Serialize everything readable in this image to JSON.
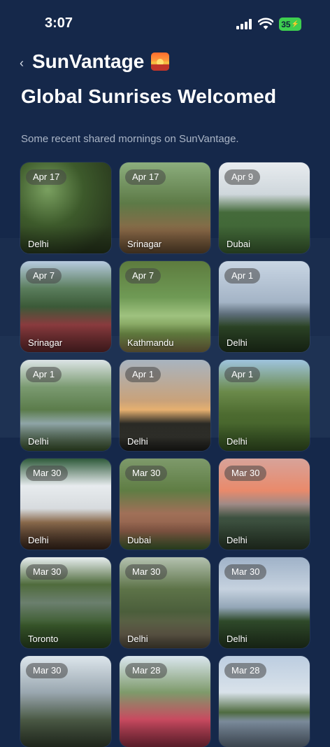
{
  "status": {
    "time": "3:07",
    "battery": "35"
  },
  "header": {
    "back_icon": "‹",
    "app_name": "SunVantage",
    "title": "Global Sunrises Welcomed",
    "subtitle": "Some recent shared mornings on SunVantage."
  },
  "photos": [
    {
      "date": "Apr 17",
      "place": "Delhi",
      "scene": "s-jungle"
    },
    {
      "date": "Apr 17",
      "place": "Srinagar",
      "scene": "s-park"
    },
    {
      "date": "Apr 9",
      "place": "Dubai",
      "scene": "s-gazebo"
    },
    {
      "date": "Apr 7",
      "place": "Srinagar",
      "scene": "s-garden"
    },
    {
      "date": "Apr 7",
      "place": "Kathmandu",
      "scene": "s-lake"
    },
    {
      "date": "Apr 1",
      "place": "Delhi",
      "scene": "s-hills"
    },
    {
      "date": "Apr 1",
      "place": "Delhi",
      "scene": "s-pond"
    },
    {
      "date": "Apr 1",
      "place": "Delhi",
      "scene": "s-dawnlake"
    },
    {
      "date": "Apr 1",
      "place": "Delhi",
      "scene": "s-trees"
    },
    {
      "date": "Mar 30",
      "place": "Delhi",
      "scene": "s-balcony"
    },
    {
      "date": "Mar 30",
      "place": "Dubai",
      "scene": "s-path"
    },
    {
      "date": "Mar 30",
      "place": "Delhi",
      "scene": "s-dusk"
    },
    {
      "date": "Mar 30",
      "place": "Toronto",
      "scene": "s-fountain"
    },
    {
      "date": "Mar 30",
      "place": "Delhi",
      "scene": "s-woods"
    },
    {
      "date": "Mar 30",
      "place": "Delhi",
      "scene": "s-cloudhills"
    },
    {
      "date": "Mar 30",
      "place": "",
      "scene": "s-sea"
    },
    {
      "date": "Mar 28",
      "place": "",
      "scene": "s-flowers"
    },
    {
      "date": "Mar 28",
      "place": "",
      "scene": "s-lake2"
    }
  ],
  "colors": {
    "background": "#15284a",
    "battery": "#3ecf4f",
    "subtitle": "#aab5c6"
  }
}
